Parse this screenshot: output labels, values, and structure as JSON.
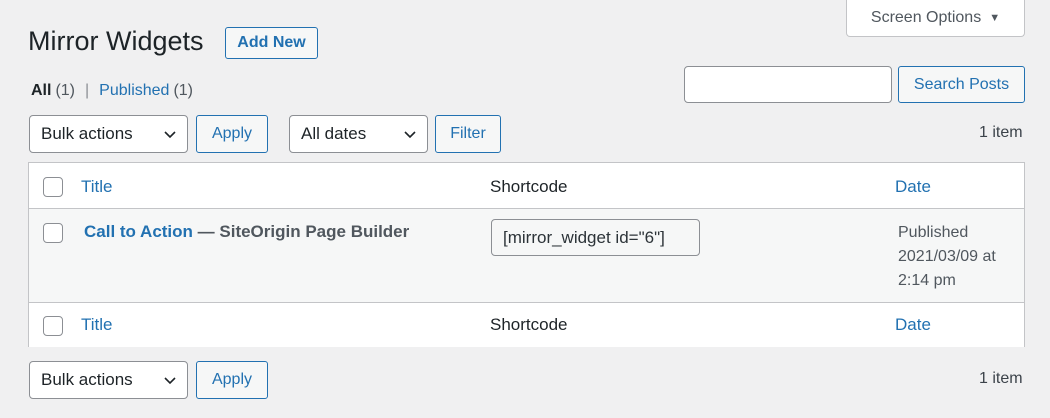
{
  "screen_options": {
    "label": "Screen Options",
    "caret_icon": "caret-down-icon"
  },
  "header": {
    "title": "Mirror Widgets",
    "add_new_label": "Add New"
  },
  "views": {
    "all_label": "All",
    "all_count": "(1)",
    "separator": "|",
    "published_label": "Published",
    "published_count": "(1)"
  },
  "search": {
    "value": "",
    "placeholder": "",
    "button_label": "Search Posts"
  },
  "toolbar_top": {
    "bulk_actions": "Bulk actions",
    "apply_label": "Apply",
    "dates": "All dates",
    "filter_label": "Filter",
    "item_count": "1 item"
  },
  "table": {
    "columns": {
      "title": "Title",
      "shortcode": "Shortcode",
      "date": "Date"
    },
    "rows": [
      {
        "title_link": "Call to Action",
        "title_suffix": " — SiteOrigin Page Builder",
        "shortcode": "[mirror_widget id=\"6\"]",
        "date_status": "Published",
        "date_value": "2021/03/09 at",
        "date_time": "2:14 pm"
      }
    ]
  },
  "toolbar_bottom": {
    "bulk_actions": "Bulk actions",
    "apply_label": "Apply",
    "item_count": "1 item"
  },
  "colors": {
    "link": "#2271b1",
    "background": "#f0f0f1",
    "border": "#c3c4c7"
  }
}
